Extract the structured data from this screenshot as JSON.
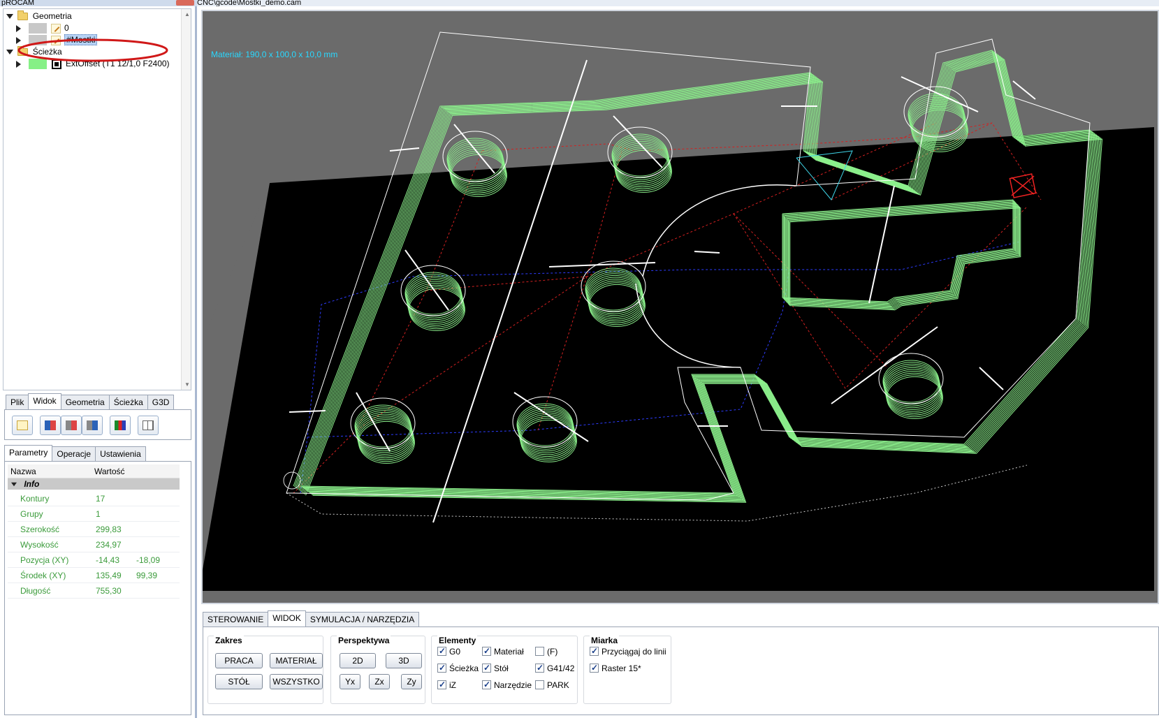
{
  "window": {
    "left_title": "pROCAM",
    "right_title": "CNC\\gcode\\Mostki_demo.cam"
  },
  "tree": {
    "geometria": "Geometria",
    "layer_0": "0",
    "layer_mostki": "#Mostki",
    "sciezka": "Ścieżka",
    "path_item": "ExtOffset (T1 12/1,0 F2400)"
  },
  "top_tabs": [
    "Plik",
    "Widok",
    "Geometria",
    "Ścieżka",
    "G3D"
  ],
  "prop_tabs": [
    "Parametry",
    "Operacje",
    "Ustawienia"
  ],
  "props": {
    "col_name": "Nazwa",
    "col_value": "Wartość",
    "section": "Info",
    "rows": [
      {
        "k": "Kontury",
        "v": "17",
        "v2": ""
      },
      {
        "k": "Grupy",
        "v": "1",
        "v2": ""
      },
      {
        "k": "Szerokość",
        "v": "299,83",
        "v2": ""
      },
      {
        "k": "Wysokość",
        "v": "234,97",
        "v2": ""
      },
      {
        "k": "Pozycja (XY)",
        "v": "-14,43",
        "v2": "-18,09"
      },
      {
        "k": "Środek (XY)",
        "v": "135,49",
        "v2": "99,39"
      },
      {
        "k": "Długość",
        "v": "755,30",
        "v2": ""
      }
    ]
  },
  "viewport": {
    "material": "Materiał: 190,0 x 100,0 x 10,0 mm"
  },
  "bottom_tabs": [
    "STEROWANIE",
    "WIDOK",
    "SYMULACJA / NARZĘDZIA"
  ],
  "bottom": {
    "zakres": {
      "title": "Zakres",
      "praca": "PRACA",
      "material": "MATERIAŁ",
      "stol": "STÓŁ",
      "wszystko": "WSZYSTKO"
    },
    "perspektywa": {
      "title": "Perspektywa",
      "b2d": "2D",
      "b3d": "3D",
      "yx": "Yx",
      "zx": "Zx",
      "zy": "Zy"
    },
    "elementy": {
      "title": "Elementy",
      "g0": "G0",
      "material": "Materiał",
      "f": "(F)",
      "sciezka": "Ścieżka",
      "stol": "Stół",
      "g4142": "G41/42",
      "iz": "iZ",
      "narzedzie": "Narzędzie",
      "park": "PARK"
    },
    "miarka": {
      "title": "Miarka",
      "przyciagaj": "Przyciągaj do linii",
      "raster": "Raster 15*"
    }
  },
  "colors": {
    "toolpath": "#8cf08c",
    "material_label": "#29d8ff",
    "highlight_ellipse": "#d01818"
  }
}
